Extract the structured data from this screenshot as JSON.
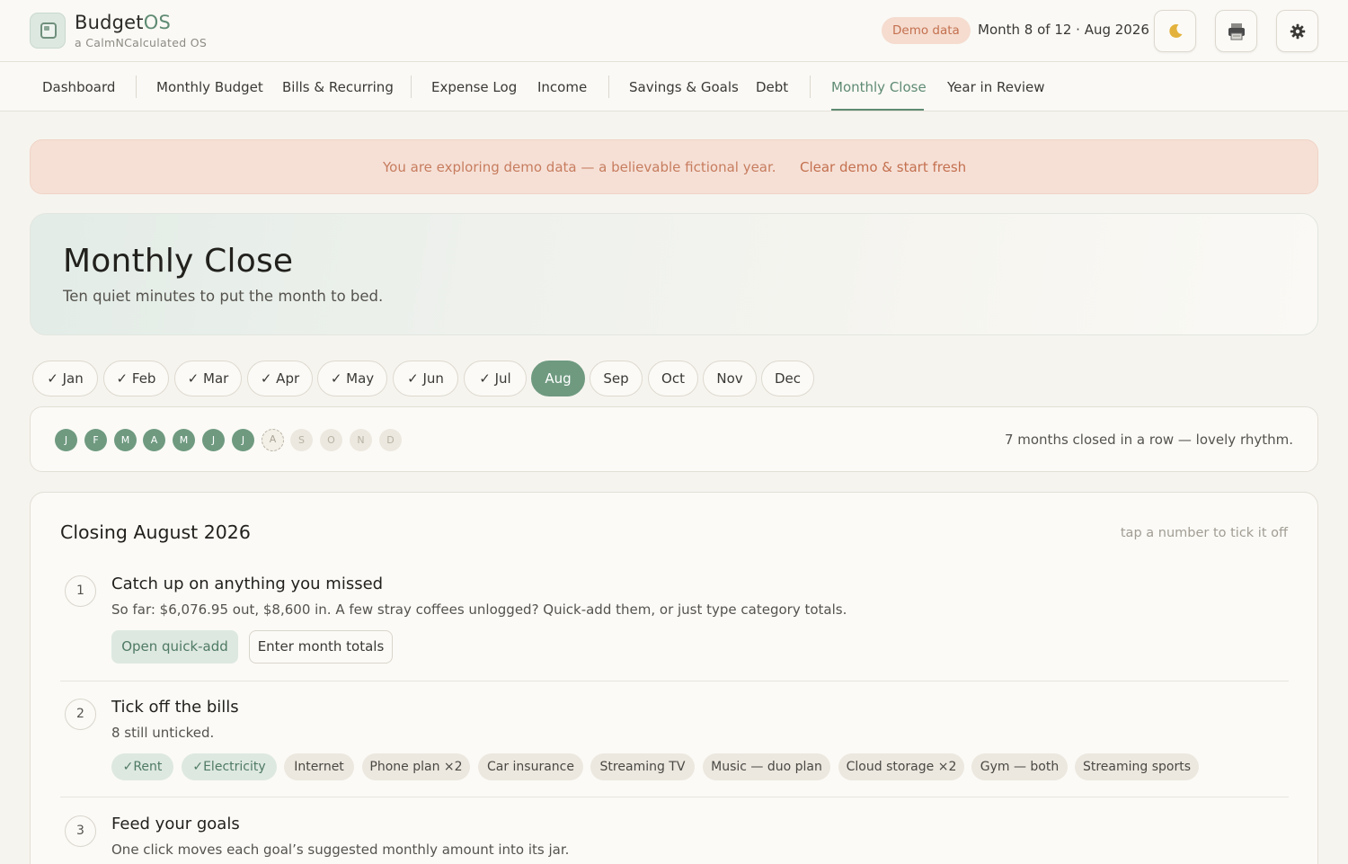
{
  "header": {
    "brand_prefix": "Budget",
    "brand_accent": "OS",
    "brand_sub": "a CalmNCalculated OS",
    "demo_badge": "Demo data",
    "month_info": "Month 8 of 12 · Aug 2026",
    "icons": [
      "moon-icon",
      "print-icon",
      "gear-icon"
    ]
  },
  "nav": {
    "items": [
      {
        "label": "Dashboard"
      },
      {
        "label": "Monthly Budget"
      },
      {
        "label": "Bills & Recurring"
      },
      {
        "label": "Expense Log"
      },
      {
        "label": "Income"
      },
      {
        "label": "Savings & Goals"
      },
      {
        "label": "Debt"
      },
      {
        "label": "Monthly Close"
      },
      {
        "label": "Year in Review"
      }
    ],
    "active": "Monthly Close"
  },
  "banner": {
    "text": "You are exploring demo data — a believable fictional year.",
    "link": "Clear demo & start fresh"
  },
  "hero": {
    "title": "Monthly Close",
    "subtitle": "Ten quiet minutes to put the month to bed."
  },
  "months": {
    "pills": [
      {
        "label": "✓ Jan"
      },
      {
        "label": "✓ Feb"
      },
      {
        "label": "✓ Mar"
      },
      {
        "label": "✓ Apr"
      },
      {
        "label": "✓ May"
      },
      {
        "label": "✓ Jun"
      },
      {
        "label": "✓ Jul"
      },
      {
        "label": "Aug"
      },
      {
        "label": "Sep"
      },
      {
        "label": "Oct"
      },
      {
        "label": "Nov"
      },
      {
        "label": "Dec"
      }
    ],
    "selected": "Aug"
  },
  "streak": {
    "dots": [
      "J",
      "F",
      "M",
      "A",
      "M",
      "J",
      "J",
      "A",
      "S",
      "O",
      "N",
      "D"
    ],
    "closed_count": 7,
    "text": "7 months closed in a row — lovely rhythm."
  },
  "close": {
    "title": "Closing August 2026",
    "hint": "tap a number to tick it off",
    "steps": [
      {
        "num": "1",
        "title": "Catch up on anything you missed",
        "desc": "So far: $6,076.95 out, $8,600 in. A few stray coffees unlogged? Quick-add them, or just type category totals.",
        "primary_button": "Open quick-add",
        "secondary_button": "Enter month totals"
      },
      {
        "num": "2",
        "title": "Tick off the bills",
        "desc": "8 still unticked.",
        "bills": [
          {
            "label": "✓Rent"
          },
          {
            "label": "✓Electricity"
          },
          {
            "label": "Internet"
          },
          {
            "label": "Phone plan ×2"
          },
          {
            "label": "Car insurance"
          },
          {
            "label": "Streaming TV"
          },
          {
            "label": "Music — duo plan"
          },
          {
            "label": "Cloud storage ×2"
          },
          {
            "label": "Gym — both"
          },
          {
            "label": "Streaming sports"
          }
        ]
      },
      {
        "num": "3",
        "title": "Feed your goals",
        "desc": "One click moves each goal’s suggested monthly amount into its jar."
      }
    ]
  },
  "colors": {
    "accent": "#5f8b73",
    "accent_fill": "#6f9a80",
    "demo": "#c4704f",
    "background": "#f6f4ef"
  }
}
